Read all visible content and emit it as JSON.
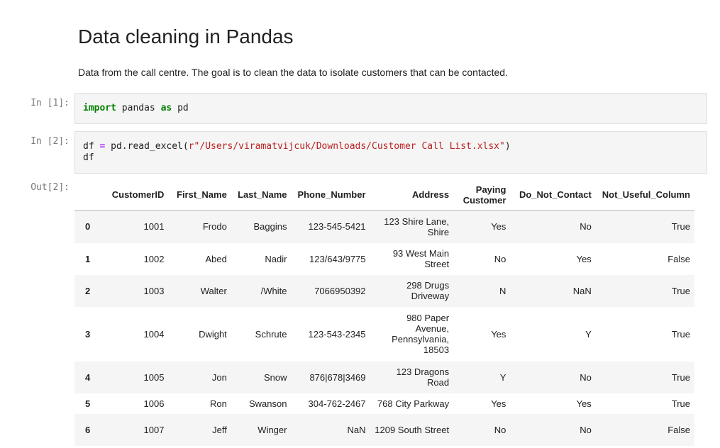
{
  "notebook": {
    "title": "Data cleaning in Pandas",
    "description": "Data from the call centre. The goal is to clean the data to isolate customers that can be contacted.",
    "cells": [
      {
        "prompt": "In [1]:"
      },
      {
        "prompt": "In [2]:"
      }
    ],
    "output_prompt": "Out[2]:"
  },
  "code": {
    "cell1": {
      "kw1": "import",
      "mod": " pandas ",
      "kw2": "as",
      "alias": " pd"
    },
    "cell2": {
      "line1_a": "df ",
      "line1_op": "=",
      "line1_b": " pd.read_excel(",
      "line1_str": "r\"/Users/viramatvijcuk/Downloads/Customer Call List.xlsx\"",
      "line1_c": ")",
      "line2": "df"
    }
  },
  "table": {
    "columns": [
      "",
      "CustomerID",
      "First_Name",
      "Last_Name",
      "Phone_Number",
      "Address",
      "Paying Customer",
      "Do_Not_Contact",
      "Not_Useful_Column"
    ],
    "rows": [
      [
        "0",
        "1001",
        "Frodo",
        "Baggins",
        "123-545-5421",
        "123 Shire Lane, Shire",
        "Yes",
        "No",
        "True"
      ],
      [
        "1",
        "1002",
        "Abed",
        "Nadir",
        "123/643/9775",
        "93 West Main Street",
        "No",
        "Yes",
        "False"
      ],
      [
        "2",
        "1003",
        "Walter",
        "/White",
        "7066950392",
        "298 Drugs Driveway",
        "N",
        "NaN",
        "True"
      ],
      [
        "3",
        "1004",
        "Dwight",
        "Schrute",
        "123-543-2345",
        "980 Paper Avenue, Pennsylvania, 18503",
        "Yes",
        "Y",
        "True"
      ],
      [
        "4",
        "1005",
        "Jon",
        "Snow",
        "876|678|3469",
        "123 Dragons Road",
        "Y",
        "No",
        "True"
      ],
      [
        "5",
        "1006",
        "Ron",
        "Swanson",
        "304-762-2467",
        "768 City Parkway",
        "Yes",
        "Yes",
        "True"
      ],
      [
        "6",
        "1007",
        "Jeff",
        "Winger",
        "NaN",
        "1209 South Street",
        "No",
        "No",
        "False"
      ]
    ]
  }
}
